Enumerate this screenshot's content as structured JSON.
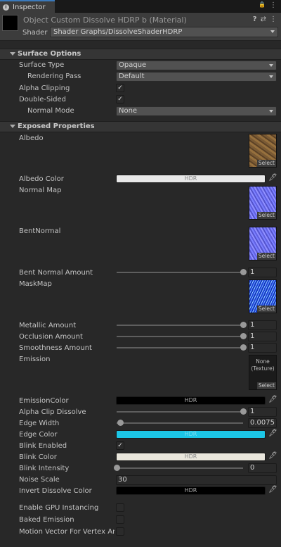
{
  "tab": {
    "title": "Inspector"
  },
  "header": {
    "material_title": "Object Custom Dissolve HDRP b (Material)",
    "shader_label": "Shader",
    "shader_value": "Shader Graphs/DissolveShaderHDRP"
  },
  "surface_options": {
    "title": "Surface Options",
    "surface_type": {
      "label": "Surface Type",
      "value": "Opaque"
    },
    "rendering_pass": {
      "label": "Rendering Pass",
      "value": "Default"
    },
    "alpha_clipping": {
      "label": "Alpha Clipping",
      "checked": true
    },
    "double_sided": {
      "label": "Double-Sided",
      "checked": true
    },
    "normal_mode": {
      "label": "Normal Mode",
      "value": "None"
    }
  },
  "exposed": {
    "title": "Exposed Properties",
    "albedo": "Albedo",
    "albedo_color": {
      "label": "Albedo Color",
      "hdr": "HDR",
      "color": "#e8e8e8"
    },
    "normal_map": "Normal Map",
    "bent_normal": "BentNormal",
    "bent_normal_amount": {
      "label": "Bent Normal Amount",
      "value": "1",
      "fraction": 1.0
    },
    "mask_map": "MaskMap",
    "metallic_amount": {
      "label": "Metallic Amount",
      "value": "1",
      "fraction": 1.0
    },
    "occlusion_amount": {
      "label": "Occlusion Amount",
      "value": "1",
      "fraction": 1.0
    },
    "smoothness_amount": {
      "label": "Smoothness Amount",
      "value": "1",
      "fraction": 1.0
    },
    "emission": {
      "label": "Emission",
      "none_line1": "None",
      "none_line2": "(Texture)"
    },
    "select": "Select",
    "emission_color": {
      "label": "EmissionColor",
      "hdr": "HDR",
      "color": "#000000"
    },
    "alpha_clip_dissolve": {
      "label": "Alpha Clip Dissolve",
      "value": "1",
      "fraction": 1.0
    },
    "edge_width": {
      "label": "Edge Width",
      "value": "0.0075",
      "fraction": 0.03
    },
    "edge_color": {
      "label": "Edge Color",
      "hdr": "HDR",
      "color": "#1cc6e6"
    },
    "blink_enabled": {
      "label": "Blink Enabled",
      "checked": true
    },
    "blink_color": {
      "label": "Blink Color",
      "hdr": "HDR",
      "color": "#e9e6dc"
    },
    "blink_intensity": {
      "label": "Blink Intensity",
      "value": "0",
      "fraction": 0.0
    },
    "noise_scale": {
      "label": "Noise Scale",
      "value": "30"
    },
    "invert_dissolve_color": {
      "label": "Invert Dissolve Color",
      "hdr": "HDR",
      "color": "#000000"
    },
    "enable_gpu_instancing": {
      "label": "Enable GPU Instancing",
      "checked": false
    },
    "baked_emission": {
      "label": "Baked Emission",
      "checked": false
    },
    "motion_vector": {
      "label": "Motion Vector For Vertex Anim",
      "checked": false
    }
  },
  "icons": {
    "help": "?",
    "settings": "⇄",
    "more": "⋮",
    "lock": "🔒",
    "eyedropper": "🖋",
    "check": "✓"
  }
}
